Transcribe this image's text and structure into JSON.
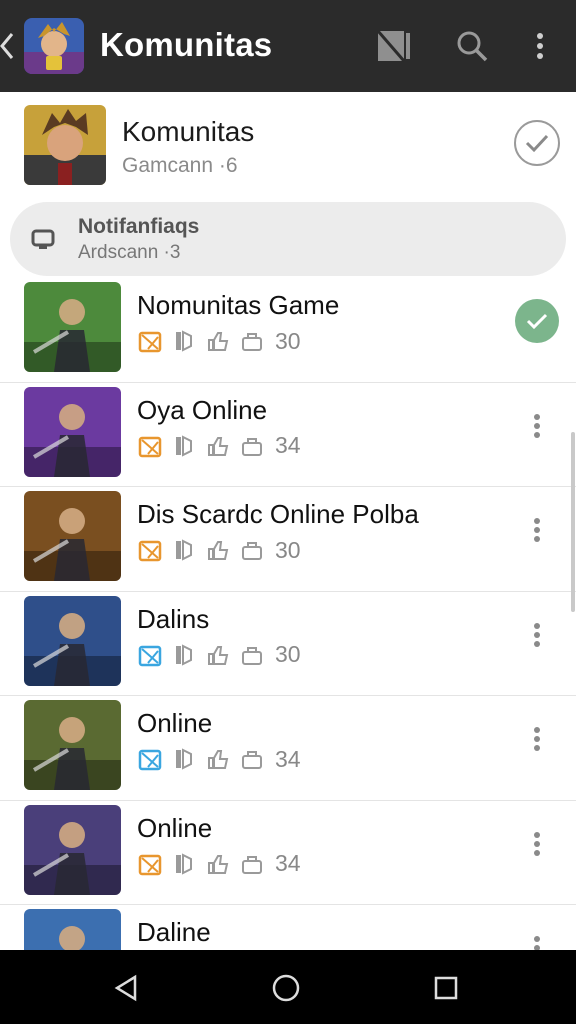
{
  "app_bar": {
    "title": "Komunitas",
    "logo_icon": "hero-logo-icon",
    "actions": [
      "back-arrow-icon",
      "bookmark-icon",
      "search-icon",
      "more-vert-icon"
    ],
    "background": "#2b2b2b"
  },
  "header_item": {
    "title": "Komunitas",
    "subtitle": "Gamcann ·6",
    "status_icon": "check-circle-outline-icon"
  },
  "notification": {
    "title": "Notifanfiaqs",
    "subtitle": "Ardscann ·3",
    "icon": "chat-bubble-icon"
  },
  "games": [
    {
      "title": "Nomunitas Game",
      "count": "30",
      "badge_color": "#e8962e",
      "state": "selected",
      "art": "#4d8a3c"
    },
    {
      "title": "Oya Online",
      "count": "34",
      "badge_color": "#e8962e",
      "state": "menu",
      "art": "#6b3aa0"
    },
    {
      "title": "Dis Scardc Online Polba",
      "count": "30",
      "badge_color": "#e8962e",
      "state": "menu",
      "art": "#7a4f20"
    },
    {
      "title": "Dalins",
      "count": "30",
      "badge_color": "#3aa6e0",
      "state": "menu",
      "art": "#2f4f8a"
    },
    {
      "title": "Online",
      "count": "34",
      "badge_color": "#3aa6e0",
      "state": "menu",
      "art": "#5a6a32"
    },
    {
      "title": "Online",
      "count": "34",
      "badge_color": "#e8962e",
      "state": "menu",
      "art": "#4a3f7a"
    },
    {
      "title": "Daline",
      "count": "",
      "badge_color": "#e8962e",
      "state": "menu",
      "art": "#3c6fb0"
    }
  ],
  "accent": {
    "selected": "#7cb58c",
    "divider": "#e4e4e4"
  },
  "system_nav": [
    "nav-back-icon",
    "nav-home-icon",
    "nav-recents-icon"
  ]
}
